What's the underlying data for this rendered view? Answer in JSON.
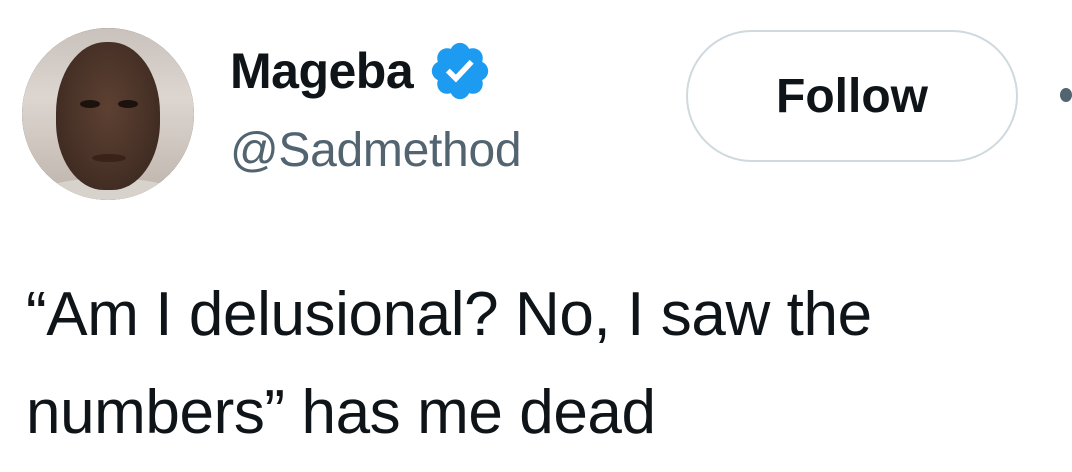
{
  "author": {
    "display_name": "Mageba",
    "handle": "@Sadmethod",
    "verified": true,
    "avatar_icon": "profile-photo",
    "verified_icon": "verified-badge-icon"
  },
  "actions": {
    "follow_label": "Follow",
    "more_icon": "more-dots-icon"
  },
  "tweet": {
    "text": "“Am I delusional? No, I saw the numbers” has me dead"
  },
  "colors": {
    "primary_text": "#0f1419",
    "secondary_text": "#536471",
    "verified_blue": "#1d9bf0",
    "button_border": "#cfd9de"
  }
}
